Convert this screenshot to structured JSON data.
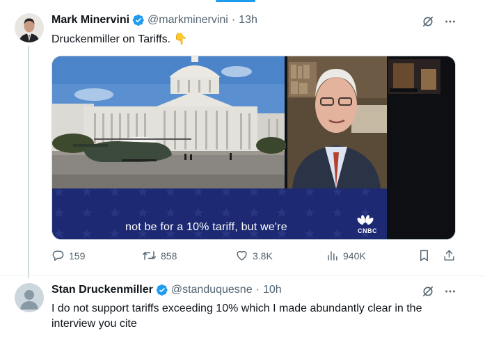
{
  "tweet1": {
    "display_name": "Mark Minervini",
    "handle": "@markminervini",
    "separator": "·",
    "time": "13h",
    "text": "Druckenmiller on Tariffs. 👇",
    "media": {
      "caption": "not be for a 10% tariff, but we're",
      "network_logo": "CNBC"
    },
    "stats": {
      "replies": "159",
      "reposts": "858",
      "likes": "3.8K",
      "views": "940K"
    }
  },
  "tweet2": {
    "display_name": "Stan Druckenmiller",
    "handle": "@standuquesne",
    "separator": "·",
    "time": "10h",
    "text_line1": "I do not support tariffs exceeding 10% which I made abundantly clear in the",
    "text_line2": "interview you cite"
  },
  "colors": {
    "accent": "#1d9bf0",
    "muted": "#536471",
    "text": "#0f1419"
  },
  "icons": [
    "grok-icon",
    "more-icon",
    "reply-icon",
    "repost-icon",
    "like-icon",
    "views-icon",
    "bookmark-icon",
    "share-icon",
    "verified-badge-icon"
  ]
}
